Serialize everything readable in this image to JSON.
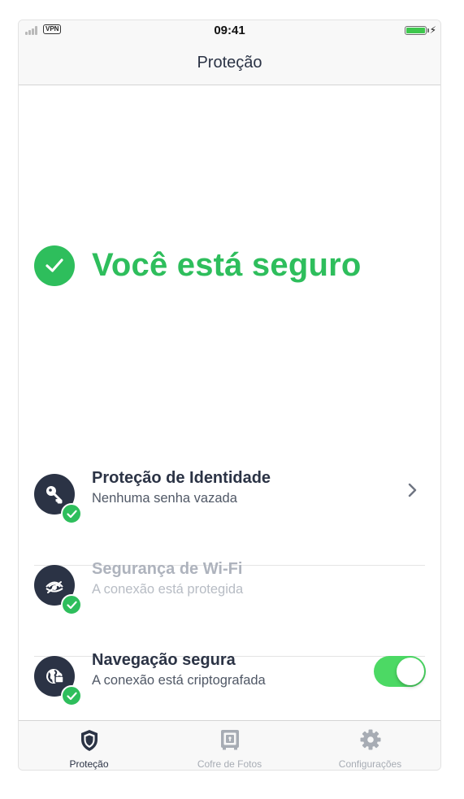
{
  "status_bar": {
    "vpn_label": "VPN",
    "time": "09:41",
    "battery_icon": "battery-charging-icon"
  },
  "header": {
    "title": "Proteção"
  },
  "status": {
    "icon": "check-circle-icon",
    "message": "Você está seguro",
    "color": "#2ebe5c"
  },
  "features": [
    {
      "icon": "key-icon",
      "title": "Proteção de Identidade",
      "subtitle": "Nenhuma senha vazada",
      "control": "chevron-right-icon",
      "enabled": true
    },
    {
      "icon": "wifi-eye-icon",
      "title": "Segurança de Wi-Fi",
      "subtitle": "A conexão está protegida",
      "enabled": false
    },
    {
      "icon": "globe-lock-icon",
      "title": "Navegação segura",
      "subtitle": "A conexão está criptografada",
      "control": "toggle",
      "toggle_on": true,
      "enabled": true
    }
  ],
  "tab_bar": {
    "tabs": [
      {
        "label": "Proteção",
        "icon": "shield-icon",
        "active": true
      },
      {
        "label": "Cofre de Fotos",
        "icon": "photo-vault-icon",
        "active": false
      },
      {
        "label": "Configurações",
        "icon": "gear-icon",
        "active": false
      }
    ]
  },
  "colors": {
    "accent_green": "#2ebe5c",
    "toggle_green": "#4cd964",
    "icon_dark": "#2b3345",
    "inactive_gray": "#a7acb4"
  }
}
